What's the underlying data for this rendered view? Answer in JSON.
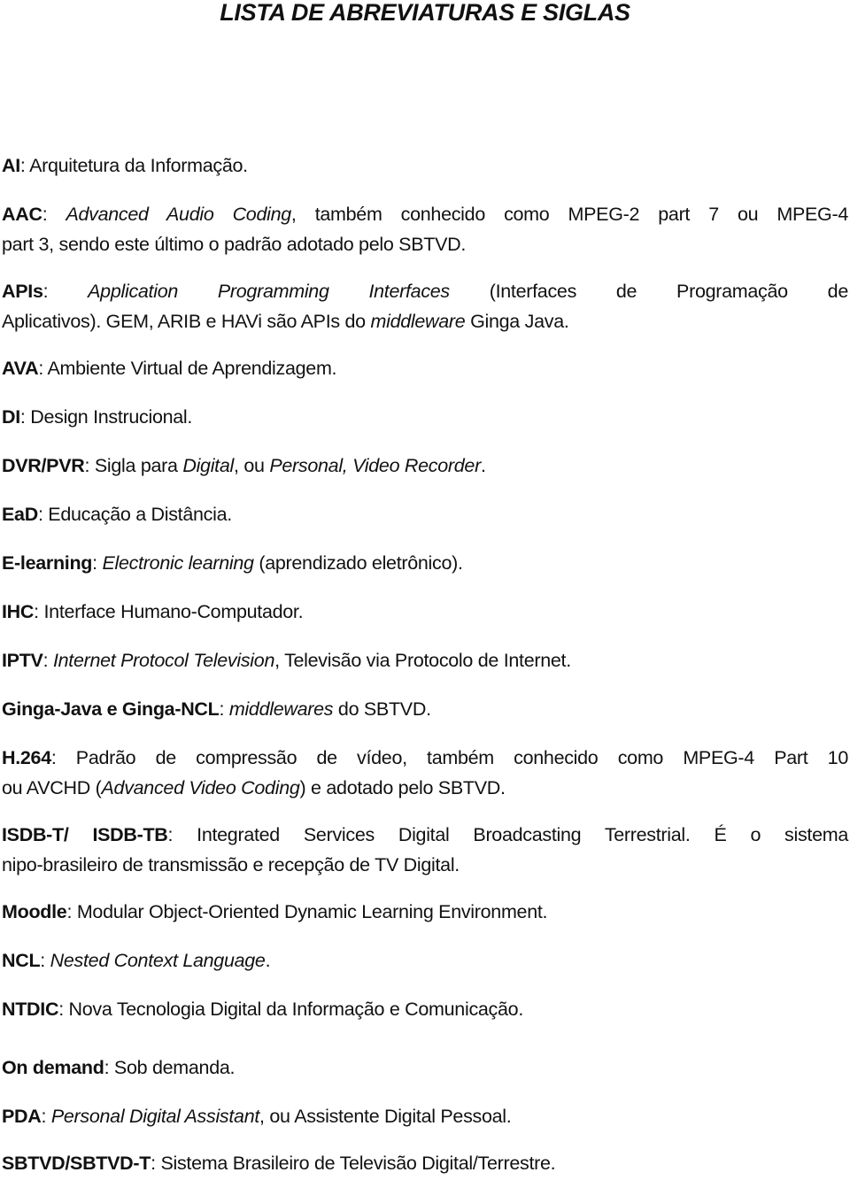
{
  "title": "LISTA DE ABREVIATURAS E SIGLAS",
  "entries": [
    {
      "term": "AI",
      "sep": ": ",
      "parts": [
        "Arquitetura da Informação."
      ]
    },
    {
      "term": "AAC",
      "sep": ": ",
      "line1": {
        "italic": "Advanced Audio Coding",
        "rest": ", também conhecido como MPEG-2 part 7 ou MPEG-4"
      },
      "line2": "part 3, sendo este último o padrão adotado pelo SBTVD."
    },
    {
      "term": "APIs",
      "sep": ": ",
      "line1": {
        "italic": "Application Programming Interfaces",
        "rest": " (Interfaces de Programação de"
      },
      "line2": {
        "pre": "Aplicativos). GEM, ARIB e HAVi são APIs do ",
        "italic": "middleware",
        "post": " Ginga Java."
      }
    },
    {
      "term": "AVA",
      "sep": ": ",
      "text": "Ambiente Virtual de Aprendizagem."
    },
    {
      "term": "DI",
      "sep": ": ",
      "text": "Design Instrucional."
    },
    {
      "term": "DVR/PVR",
      "sep": ": ",
      "pre": "Sigla para ",
      "italic1": "Digital",
      "mid": ", ou ",
      "italic2": "Personal, Video Recorder",
      "post": "."
    },
    {
      "term": "EaD",
      "sep": ": ",
      "text": "Educação a Distância."
    },
    {
      "term": "E-learning",
      "sep": ": ",
      "italic": "Electronic learning",
      "post": " (aprendizado eletrônico)."
    },
    {
      "term": "IHC",
      "sep": ": ",
      "text": "Interface Humano-Computador."
    },
    {
      "term": "IPTV",
      "sep": ": ",
      "italic": "Internet Protocol Television",
      "post": ", Televisão via Protocolo de Internet."
    },
    {
      "term": "Ginga-Java e Ginga-NCL",
      "sep": ": ",
      "italic": "middlewares",
      "post": " do SBTVD."
    },
    {
      "term": "H.264",
      "sep": ": ",
      "line1": "Padrão de compressão de vídeo, também conhecido como MPEG-4 Part 10",
      "line2": {
        "pre": "ou AVCHD (",
        "italic": "Advanced Video Coding",
        "post": ") e adotado pelo SBTVD."
      }
    },
    {
      "term": "ISDB-T/ ISDB-TB",
      "sep": ": ",
      "line1": "Integrated Services Digital Broadcasting Terrestrial. É o sistema",
      "line2": "nipo-brasileiro de transmissão e recepção de TV Digital."
    },
    {
      "term": "Moodle",
      "sep": ": ",
      "text": "Modular Object-Oriented Dynamic Learning Environment."
    },
    {
      "term": "NCL",
      "sep": ": ",
      "italic": "Nested Context Language",
      "post": "."
    },
    {
      "term": "NTDIC",
      "sep": ": ",
      "text": "Nova Tecnologia Digital da Informação e Comunicação."
    },
    {
      "term": "On demand",
      "sep": ": ",
      "text": "Sob demanda."
    },
    {
      "term": "PDA",
      "sep": ": ",
      "italic": "Personal Digital Assistant",
      "post": ", ou Assistente Digital Pessoal."
    },
    {
      "term": "SBTVD/SBTVD-T",
      "sep": ": ",
      "text": "Sistema Brasileiro de Televisão Digital/Terrestre."
    }
  ]
}
